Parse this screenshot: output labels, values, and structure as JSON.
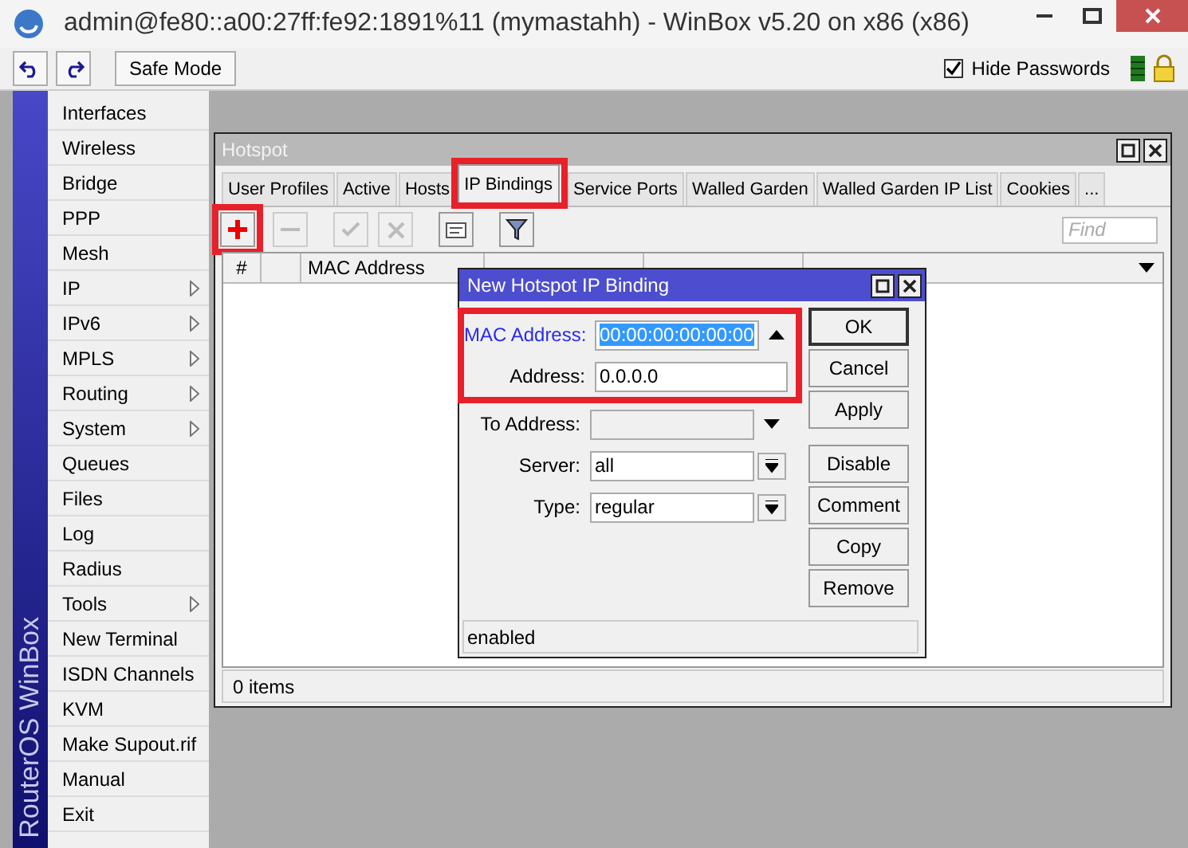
{
  "window": {
    "title": "admin@fe80::a00:27ff:fe92:1891%11 (mymastahh) - WinBox v5.20 on x86 (x86)"
  },
  "toolbar": {
    "safe_mode": "Safe Mode",
    "hide_passwords": {
      "label": "Hide Passwords",
      "checked": true
    }
  },
  "sidebar": {
    "brand": "RouterOS WinBox",
    "items": [
      {
        "label": "Interfaces",
        "submenu": false
      },
      {
        "label": "Wireless",
        "submenu": false
      },
      {
        "label": "Bridge",
        "submenu": false
      },
      {
        "label": "PPP",
        "submenu": false
      },
      {
        "label": "Mesh",
        "submenu": false
      },
      {
        "label": "IP",
        "submenu": true
      },
      {
        "label": "IPv6",
        "submenu": true
      },
      {
        "label": "MPLS",
        "submenu": true
      },
      {
        "label": "Routing",
        "submenu": true
      },
      {
        "label": "System",
        "submenu": true
      },
      {
        "label": "Queues",
        "submenu": false
      },
      {
        "label": "Files",
        "submenu": false
      },
      {
        "label": "Log",
        "submenu": false
      },
      {
        "label": "Radius",
        "submenu": false
      },
      {
        "label": "Tools",
        "submenu": true
      },
      {
        "label": "New Terminal",
        "submenu": false
      },
      {
        "label": "ISDN Channels",
        "submenu": false
      },
      {
        "label": "KVM",
        "submenu": false
      },
      {
        "label": "Make Supout.rif",
        "submenu": false
      },
      {
        "label": "Manual",
        "submenu": false
      },
      {
        "label": "Exit",
        "submenu": false
      }
    ]
  },
  "hotspot": {
    "title": "Hotspot",
    "tabs": [
      {
        "label": "User Profiles",
        "selected": false,
        "highlighted": false
      },
      {
        "label": "Active",
        "selected": false,
        "highlighted": false
      },
      {
        "label": "Hosts",
        "selected": false,
        "highlighted": false
      },
      {
        "label": "IP Bindings",
        "selected": true,
        "highlighted": true
      },
      {
        "label": "Service Ports",
        "selected": false,
        "highlighted": false
      },
      {
        "label": "Walled Garden",
        "selected": false,
        "highlighted": false
      },
      {
        "label": "Walled Garden IP List",
        "selected": false,
        "highlighted": false
      },
      {
        "label": "Cookies",
        "selected": false,
        "highlighted": false
      },
      {
        "label": "...",
        "selected": false,
        "highlighted": false
      }
    ],
    "tools": [
      {
        "kind": "add",
        "disabled": false,
        "highlighted": true
      },
      {
        "kind": "remove",
        "disabled": true,
        "highlighted": false
      },
      {
        "kind": "enable",
        "disabled": true,
        "highlighted": false
      },
      {
        "kind": "disable",
        "disabled": true,
        "highlighted": false
      },
      {
        "kind": "comment",
        "disabled": false,
        "highlighted": false
      },
      {
        "kind": "filter",
        "disabled": false,
        "highlighted": false
      }
    ],
    "find": {
      "placeholder": "Find"
    },
    "columns": [
      "#",
      "",
      "MAC Address"
    ],
    "status": "0 items"
  },
  "dialog": {
    "title": "New Hotspot IP Binding",
    "fields": [
      {
        "label": "MAC Address:",
        "value": "00:00:00:00:00:00",
        "kind": "collapse",
        "focused": true,
        "disabled": false,
        "highlighted": true
      },
      {
        "label": "Address:",
        "value": "0.0.0.0",
        "kind": "plain",
        "focused": false,
        "disabled": false,
        "highlighted": true
      },
      {
        "label": "To Address:",
        "kind": "expand",
        "focused": false,
        "disabled": true,
        "highlighted": false
      },
      {
        "label": "Server:",
        "value": "all",
        "kind": "select",
        "focused": false,
        "disabled": false,
        "highlighted": false
      },
      {
        "label": "Type:",
        "value": "regular",
        "kind": "select",
        "focused": false,
        "disabled": false,
        "highlighted": false
      }
    ],
    "button_groups": [
      [
        {
          "label": "OK",
          "default": true
        },
        {
          "label": "Cancel",
          "default": false
        },
        {
          "label": "Apply",
          "default": false
        }
      ],
      [
        {
          "label": "Disable",
          "default": false
        },
        {
          "label": "Comment",
          "default": false
        },
        {
          "label": "Copy",
          "default": false
        },
        {
          "label": "Remove",
          "default": false
        }
      ]
    ],
    "status": "enabled"
  }
}
